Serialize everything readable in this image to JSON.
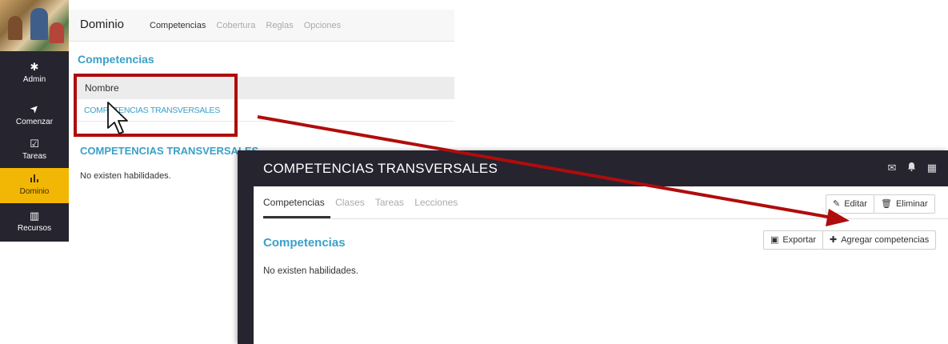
{
  "left_panel": {
    "sidebar": {
      "items": [
        {
          "label": "Admin",
          "icon": "gear-icon",
          "glyph": "✱"
        },
        {
          "label": "Comenzar",
          "icon": "send-icon",
          "glyph": "➤"
        },
        {
          "label": "Tareas",
          "icon": "checkbox-icon",
          "glyph": "☑"
        },
        {
          "label": "Dominio",
          "icon": "bar-chart-icon",
          "glyph": "▮",
          "active": true
        },
        {
          "label": "Recursos",
          "icon": "columns-icon",
          "glyph": "▥"
        }
      ]
    },
    "topbar": {
      "title": "Dominio",
      "tabs": [
        "Competencias",
        "Cobertura",
        "Reglas",
        "Opciones"
      ],
      "active_tab": "Competencias"
    },
    "heading": "Competencias",
    "table": {
      "columns": [
        "Nombre"
      ],
      "rows": [
        [
          "COMPETENCIAS TRANSVERSALES"
        ]
      ]
    },
    "sub_heading": "COMPETENCIAS TRANSVERSALES",
    "empty_message": "No existen habilidades."
  },
  "right_panel": {
    "title": "COMPETENCIAS TRANSVERSALES",
    "header_icons": [
      "mail-icon",
      "bell-icon",
      "calendar-icon"
    ],
    "tabs": [
      "Competencias",
      "Clases",
      "Tareas",
      "Lecciones"
    ],
    "active_tab": "Competencias",
    "edit_label": "Editar",
    "delete_label": "Eliminar",
    "heading": "Competencias",
    "export_label": "Exportar",
    "add_label": "Agregar competencias",
    "empty_message": "No existen habilidades."
  },
  "colors": {
    "sidebar_bg": "#26242f",
    "active_nav": "#f2b705",
    "accent_link": "#3aa0c8",
    "highlight_red": "#b00c0c"
  }
}
